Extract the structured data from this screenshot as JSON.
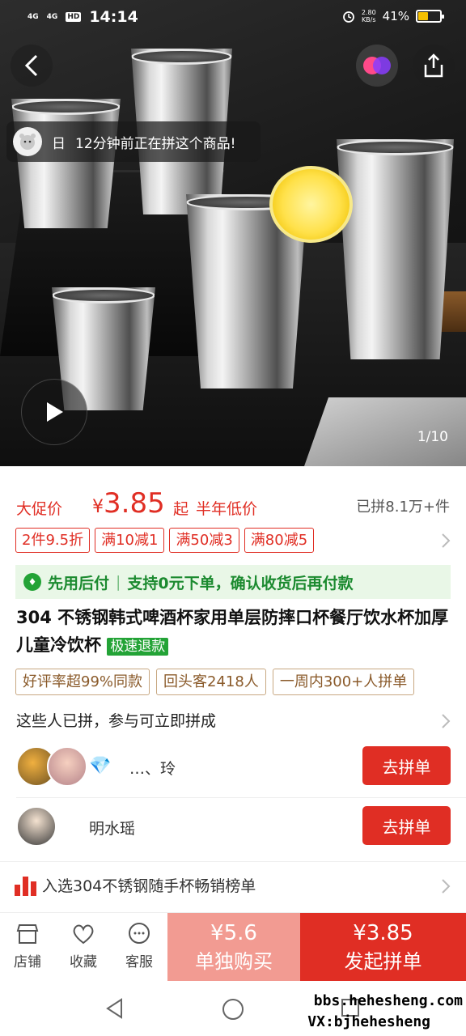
{
  "status_bar": {
    "network1": "4G",
    "network2": "4G",
    "hd": "HD",
    "time": "14:14",
    "speed_value": "2.80",
    "speed_unit": "KB/s",
    "battery": "41%"
  },
  "hero": {
    "buzz_name": "日",
    "buzz_text": "12分钟前正在拼这个商品!",
    "page_indicator": "1/10"
  },
  "price": {
    "label": "大促价",
    "currency": "¥",
    "value": "3.85",
    "qi": "起",
    "low_tag": "半年低价",
    "sold": "已拼8.1万+件"
  },
  "coupons": [
    "2件9.5折",
    "满10减1",
    "满50减3",
    "满80减5"
  ],
  "pay_later": {
    "label": "先用后付",
    "separator": "|",
    "text": "支持0元下单，确认收货后再付款"
  },
  "product": {
    "title": "304  不锈钢韩式啤酒杯家用单层防摔口杯餐厅饮水杯加厚儿童冷饮杯",
    "tag": "极速退款"
  },
  "badges": [
    "好评率超99%同款",
    "回头客2418人",
    "一周内300+人拼单"
  ],
  "groups": {
    "heading": "这些人已拼，参与可立即拼成",
    "rows": [
      {
        "name": "…、玲",
        "button": "去拼单"
      },
      {
        "name": "明水瑶",
        "button": "去拼单"
      }
    ]
  },
  "ranking": "入选304不锈钢随手杯畅销榜单",
  "bottom": {
    "store": "店铺",
    "favorite": "收藏",
    "service": "客服",
    "alone_price": "¥5.6",
    "alone_label": "单独购买",
    "group_price": "¥3.85",
    "group_label": "发起拼单"
  },
  "watermark": {
    "line1": "bbs.hehesheng.com",
    "line2": "VX:bjhehesheng"
  },
  "colors": {
    "accent_red": "#e02e24",
    "pay_green": "#23a336",
    "light_red": "#f29b92"
  }
}
